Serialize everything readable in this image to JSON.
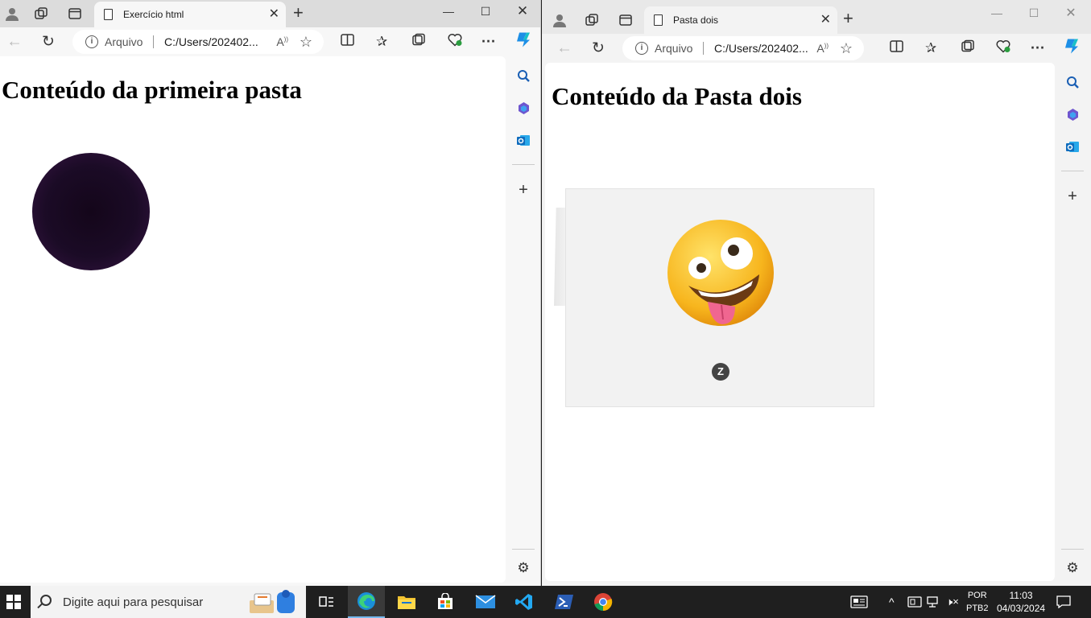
{
  "left_window": {
    "tab_title": "Exercício html",
    "address_label": "Arquivo",
    "address_url": "C:/Users/202402...",
    "page_heading": "Conteúdo da primeira pasta",
    "image_desc": "eclipse-image"
  },
  "right_window": {
    "tab_title": "Pasta dois",
    "address_label": "Arquivo",
    "address_url": "C:/Users/202402...",
    "page_heading": "Conteúdo da Pasta dois",
    "image_desc": "zany-face-emoji-image"
  },
  "taskbar": {
    "search_placeholder": "Digite aqui para pesquisar",
    "apps": [
      "task-view",
      "edge",
      "file-explorer",
      "microsoft-store",
      "mail",
      "vscode",
      "powershell",
      "chrome"
    ],
    "lang_top": "POR",
    "lang_bottom": "PTB2",
    "time": "11:03",
    "date": "04/03/2024"
  },
  "colors": {
    "accent": "#0078d4",
    "taskbar_bg": "#1f1f1f",
    "active_indicator": "#76b9ed"
  }
}
